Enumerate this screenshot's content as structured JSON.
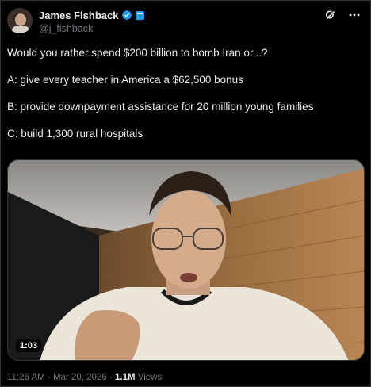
{
  "author": {
    "display_name": "James Fishback",
    "handle": "@j_fishback"
  },
  "tweet": {
    "lines": [
      "Would you rather spend $200 billion to bomb Iran or...?",
      "A: give every teacher in America a $62,500 bonus",
      "B: provide downpayment assistance for 20 million young families",
      "C: build 1,300 rural hospitals"
    ]
  },
  "video": {
    "duration": "1:03"
  },
  "meta": {
    "time": "11:26 AM",
    "separator1": " · ",
    "date": "Mar 20, 2026",
    "separator2": " · ",
    "views_count": "1.1M",
    "views_label": " Views"
  },
  "colors": {
    "verified": "#1d9bf0",
    "text_primary": "#e7e9ea",
    "text_secondary": "#71767b",
    "background": "#000000"
  },
  "icons": [
    "verified-badge-icon",
    "affiliate-badge-icon",
    "grok-icon",
    "more-icon"
  ]
}
